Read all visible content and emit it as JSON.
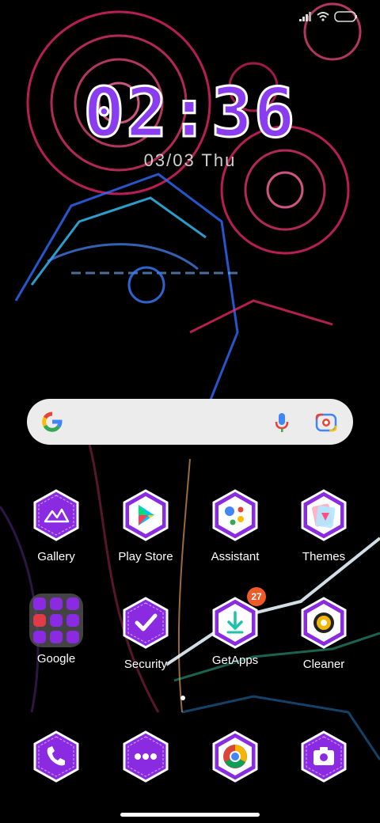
{
  "clock": {
    "time": "02:36",
    "date": "03/03 Thu"
  },
  "status": {
    "icons": [
      "signal-icon",
      "wifi-icon",
      "battery-icon"
    ]
  },
  "search": {
    "icons": [
      "google-logo-icon",
      "microphone-icon",
      "lens-camera-icon"
    ]
  },
  "apps": {
    "gallery": {
      "label": "Gallery",
      "icon": "gallery-icon"
    },
    "play_store": {
      "label": "Play Store",
      "icon": "play-store-icon"
    },
    "assistant": {
      "label": "Assistant",
      "icon": "assistant-icon"
    },
    "themes": {
      "label": "Themes",
      "icon": "themes-icon"
    },
    "google": {
      "label": "Google",
      "icon": "google-folder-icon"
    },
    "security": {
      "label": "Security",
      "icon": "security-icon"
    },
    "getapps": {
      "label": "GetApps",
      "icon": "getapps-icon",
      "badge": "27"
    },
    "cleaner": {
      "label": "Cleaner",
      "icon": "cleaner-icon"
    }
  },
  "dock": [
    "phone-icon",
    "messages-icon",
    "chrome-icon",
    "camera-icon"
  ],
  "colors": {
    "hex_purple": "#8a2be2",
    "badge": "#f05a28",
    "clock_fill": "#8a3cf0"
  }
}
